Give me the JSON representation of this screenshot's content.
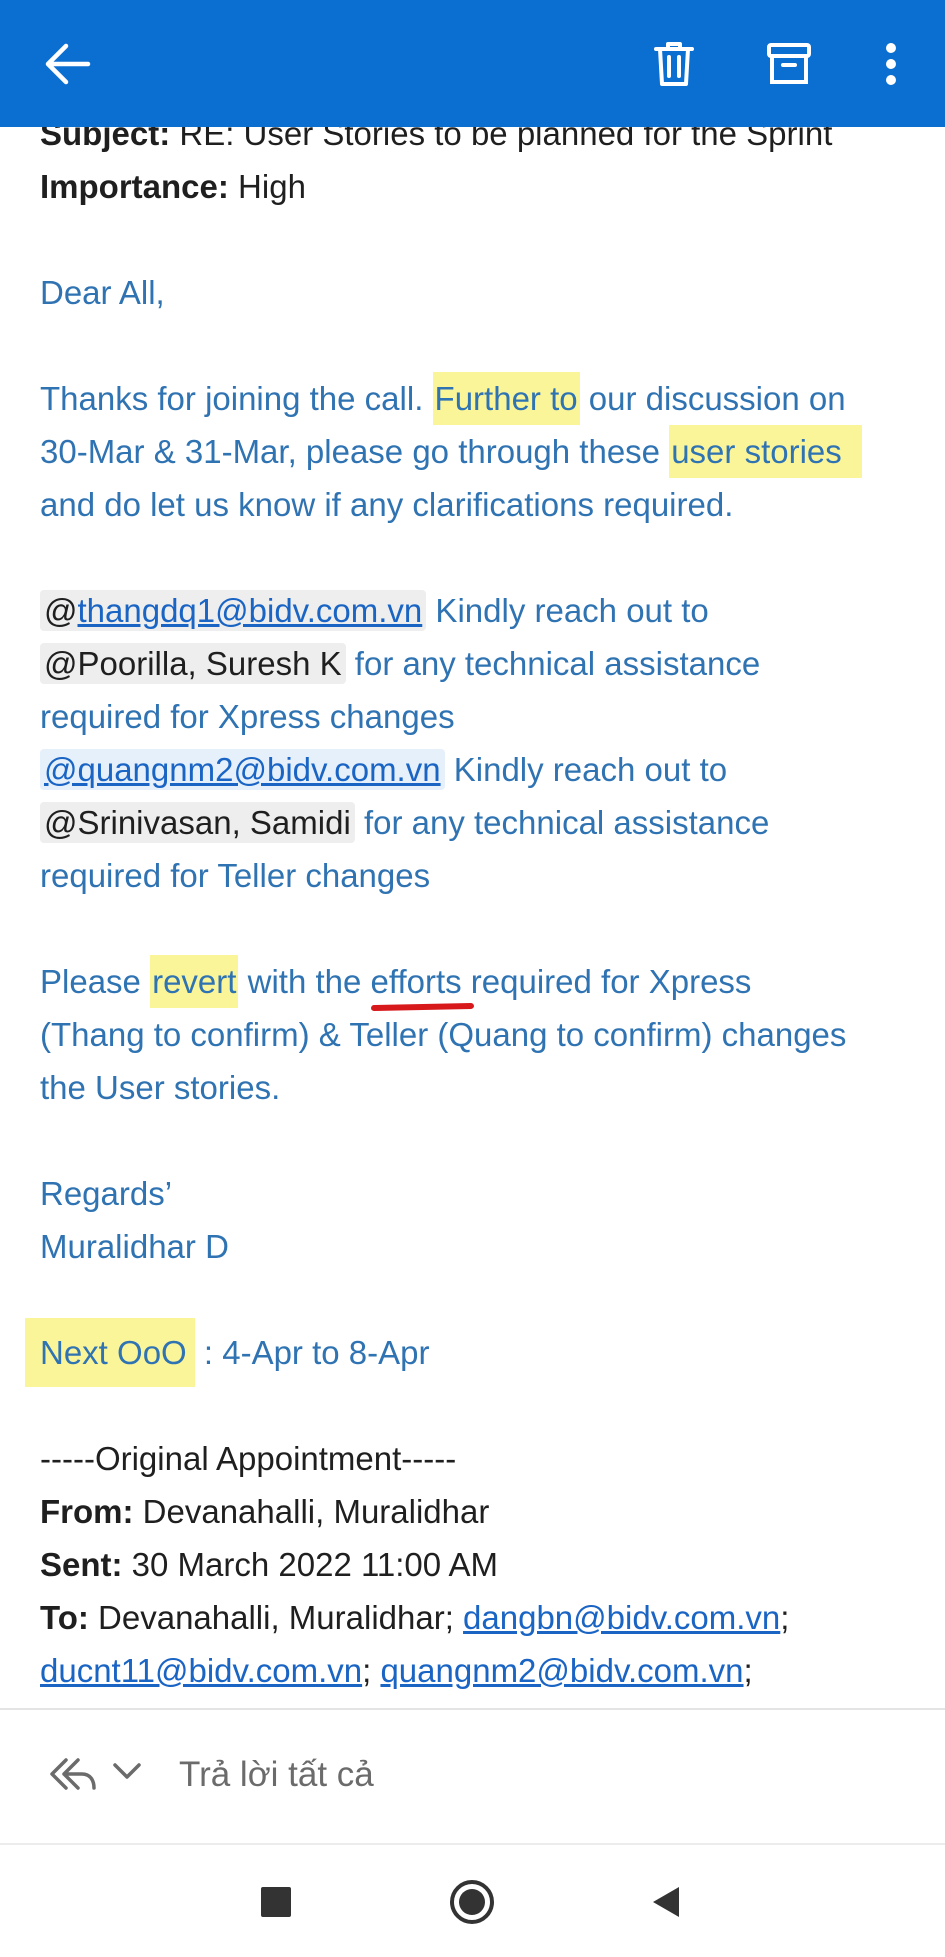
{
  "toolbar": {
    "back_icon": "arrow-left-icon",
    "delete_icon": "trash-icon",
    "archive_icon": "archive-icon",
    "more_icon": "more-vertical-icon",
    "accent": "#0b6fd1"
  },
  "header": {
    "subject_label": "Subject:",
    "subject_value": "RE: User Stories to be planned for the Sprint",
    "importance_label": "Importance:",
    "importance_value": "High"
  },
  "body": {
    "greeting": "Dear All,",
    "p1_a": "Thanks for joining the call. ",
    "p1_hl1": "Further to",
    "p1_b": " our discussion on",
    "p1_c": "30-Mar & 31-Mar, please go through these ",
    "p1_hl2": "user stories",
    "p1_d": "and do let us know if any clarifications required.",
    "m1_at": "@",
    "m1_email": "thangdq1@bidv.com.vn",
    "m1_text": " Kindly reach out to",
    "m2_name": "@Poorilla, Suresh K",
    "m2_text": " for any technical assistance",
    "m2_cont": "required for Xpress changes",
    "m3_email": "@quangnm2@bidv.com.vn",
    "m3_text": " Kindly reach out to",
    "m4_name": "@Srinivasan, Samidi",
    "m4_text": " for any technical assistance",
    "m4_cont": "required for Teller changes",
    "p3_a": "Please ",
    "p3_hl": "revert",
    "p3_b": " with the ",
    "p3_ul": "efforts",
    "p3_c": " required for Xpress",
    "p3_d": "(Thang to confirm) & Teller (Quang to confirm) changes",
    "p3_e": "the User stories.",
    "regards": "Regards’",
    "signature": "Muralidhar D",
    "ooo_hl": "Next OoO",
    "ooo_text": " : 4-Apr to 8-Apr"
  },
  "original": {
    "heading": "-----Original Appointment-----",
    "from_label": "From:",
    "from_value": " Devanahalli, Muralidhar",
    "sent_label": "Sent:",
    "sent_value": " 30 March 2022 11:00 AM",
    "to_label": "To:",
    "to_value": " Devanahalli, Muralidhar; ",
    "to_email1": "dangbn@bidv.com.vn",
    "to_email2": "ducnt11@bidv.com.vn",
    "to_email3": "quangnm2@bidv.com.vn",
    "sep": ";",
    "sep_space": "; "
  },
  "reply_bar": {
    "reply_icon": "reply-all-icon",
    "chevron_icon": "chevron-down-icon",
    "label": "Trả lời tất cả"
  },
  "navbar": {
    "recents_icon": "square-icon",
    "home_icon": "circle-icon",
    "back_icon": "triangle-back-icon"
  },
  "colors": {
    "body_text_blue": "#2f73b2",
    "highlight": "#fbf59a",
    "link": "#1a64c4",
    "underline_mark": "#d7191c"
  }
}
